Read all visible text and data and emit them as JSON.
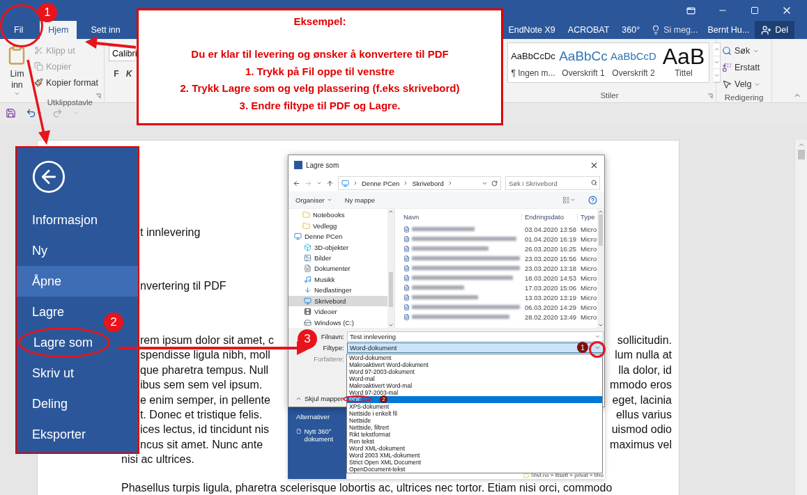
{
  "tabs": [
    {
      "label": "Fil",
      "selected": false
    },
    {
      "label": "Hjem",
      "selected": true
    },
    {
      "label": "Sett inn",
      "selected": false
    },
    {
      "label": "EndNote X9",
      "selected": false
    },
    {
      "label": "ACROBAT",
      "selected": false
    },
    {
      "label": "360°",
      "selected": false
    }
  ],
  "tell_me": {
    "placeholder": "Si meg..."
  },
  "user": "Bernt Hu...",
  "share_button": "Del",
  "ribbon": {
    "clipboard": {
      "paste": "Lim inn",
      "actions": [
        {
          "label": "Klipp ut",
          "kind": "cut",
          "disabled": true
        },
        {
          "label": "Kopier",
          "kind": "copy",
          "disabled": true
        },
        {
          "label": "Kopier format",
          "kind": "format",
          "disabled": false
        }
      ],
      "title": "Utklippstavle"
    },
    "font": {
      "name": "Calibri",
      "buttons": [
        "F",
        "K"
      ]
    },
    "styles": {
      "items": [
        {
          "sample": "AaBbCcDc",
          "label": "¶ Ingen m...",
          "kind": "normal"
        },
        {
          "sample": "AaBbCc",
          "label": "Overskrift 1",
          "kind": "heading1"
        },
        {
          "sample": "AaBbCcD",
          "label": "Overskrift 2",
          "kind": "heading2"
        },
        {
          "sample": "AaB",
          "label": "Tittel",
          "kind": "title"
        }
      ],
      "title": "Stiler"
    },
    "editing": {
      "items": [
        {
          "label": "Søk",
          "kind": "search"
        },
        {
          "label": "Erstatt",
          "kind": "replace"
        },
        {
          "label": "Velg",
          "kind": "select"
        }
      ],
      "title": "Redigering"
    }
  },
  "callout": {
    "title": "Eksempel:",
    "lines": [
      "Du er klar til levering og ønsker å konvertere til PDF",
      "1. Trykk på Fil oppe til venstre",
      "2. Trykk Lagre som og velg plassering (f.eks skrivebord)",
      "3. Endre filtype til PDF og Lagre."
    ]
  },
  "backstage": {
    "items": [
      {
        "label": "Informasjon",
        "selected": false,
        "highlighted": false
      },
      {
        "label": "Ny",
        "selected": false,
        "highlighted": false
      },
      {
        "label": "Åpne",
        "selected": true,
        "highlighted": false
      },
      {
        "label": "Lagre",
        "selected": false,
        "highlighted": false
      },
      {
        "label": "Lagre som",
        "selected": false,
        "highlighted": true
      },
      {
        "label": "Skriv ut",
        "selected": false,
        "highlighted": false
      },
      {
        "label": "Deling",
        "selected": false,
        "highlighted": false
      },
      {
        "label": "Eksporter",
        "selected": false,
        "highlighted": false
      }
    ]
  },
  "document": {
    "headings": [
      "t innlevering",
      "nvertering til PDF"
    ],
    "lines": [
      {
        "left": "rem ipsum dolor sit amet, c",
        "right": "sollicitudin."
      },
      {
        "left": "spendisse ligula nibh, moll",
        "right": "lum nulla at"
      },
      {
        "left": "que pharetra tempus. Null",
        "right": "lla dolor, id"
      },
      {
        "left": "ibus sem sem vel ipsum.",
        "right": "mmodo eros"
      },
      {
        "left": "e enim semper, in pellente",
        "right": "eget, lacinia"
      },
      {
        "left": "t. Donec et tristique felis.",
        "right": "ellus varius"
      },
      {
        "left": "ices lectus, id tincidunt nis",
        "right": "uismod odio"
      },
      {
        "left": "ncus sit amet. Nunc ante",
        "right": "maximus vel"
      }
    ],
    "last_line": "nisi ac ultrices.",
    "next_paragraph": "Phasellus turpis ligula, pharetra scelerisque lobortis ac, ultrices nec tortor. Etiam nisi orci, commodo"
  },
  "dialog": {
    "title": "Lagre som",
    "path": [
      "Denne PCen",
      "Skrivebord"
    ],
    "search": {
      "placeholder": "Søk i Skrivebord"
    },
    "organize": "Organiser",
    "new_folder": "Ny mappe",
    "nav": [
      {
        "label": "Notebooks",
        "kind": "folder",
        "selected": false
      },
      {
        "label": "Vedlegg",
        "kind": "folder",
        "selected": false
      },
      {
        "label": "Denne PCen",
        "kind": "pc",
        "selected": false,
        "children": [
          {
            "label": "3D-objekter",
            "kind": "objects3d",
            "selected": false
          },
          {
            "label": "Bilder",
            "kind": "pictures",
            "selected": false
          },
          {
            "label": "Dokumenter",
            "kind": "documents",
            "selected": false
          },
          {
            "label": "Musikk",
            "kind": "music",
            "selected": false
          },
          {
            "label": "Nedlastinger",
            "kind": "downloads",
            "selected": false
          },
          {
            "label": "Skrivebord",
            "kind": "desktop",
            "selected": true
          },
          {
            "label": "Videoer",
            "kind": "videos",
            "selected": false
          },
          {
            "label": "Windows (C:)",
            "kind": "drive",
            "selected": false
          }
        ]
      }
    ],
    "columns": [
      "Navn",
      "Endringsdato",
      "Type"
    ],
    "rows": [
      {
        "date": "03.04.2020 13:58",
        "type": "Micro"
      },
      {
        "date": "01.04.2020 16:19",
        "type": "Micro"
      },
      {
        "date": "26.03.2020 16:25",
        "type": "Micro"
      },
      {
        "date": "23.03.2020 15:56",
        "type": "Micro"
      },
      {
        "date": "23.03.2020 13:18",
        "type": "Micro"
      },
      {
        "date": "18.03.2020 14:53",
        "type": "Micro"
      },
      {
        "date": "17.03.2020 15:06",
        "type": "Micro"
      },
      {
        "date": "13.03.2020 13:19",
        "type": "Micro"
      },
      {
        "date": "06.03.2020 14:29",
        "type": "Micro"
      },
      {
        "date": "28.02.2020 13:49",
        "type": "Micro"
      }
    ],
    "filename_label": "Filnavn:",
    "filename": "Test innlevering",
    "filetype_label": "Filtype:",
    "filetype": "Word-dokument",
    "authors_label": "Forfattere:",
    "hide_folders": "Skjul mapper",
    "filetype_options": [
      {
        "label": "Word-dokument",
        "selected": false
      },
      {
        "label": "Makroaktivert Word-dokument",
        "selected": false
      },
      {
        "label": "Word 97-2003-dokument",
        "selected": false
      },
      {
        "label": "Word-mal",
        "selected": false
      },
      {
        "label": "Makroaktivert Word-mal",
        "selected": false
      },
      {
        "label": "Word 97-2003-mal",
        "selected": false
      },
      {
        "label": "PDF",
        "selected": true
      },
      {
        "label": "XPS-dokument",
        "selected": false
      },
      {
        "label": "Nettside i enkelt fil",
        "selected": false
      },
      {
        "label": "Nettside",
        "selected": false
      },
      {
        "label": "Nettside, filtrert",
        "selected": false
      },
      {
        "label": "Rikt tekstformat",
        "selected": false
      },
      {
        "label": "Ren tekst",
        "selected": false
      },
      {
        "label": "Word XML-dokument",
        "selected": false
      },
      {
        "label": "Word 2003 XML-dokument",
        "selected": false
      },
      {
        "label": "Strict Open XML Document",
        "selected": false
      },
      {
        "label": "OpenDocument-tekst",
        "selected": false
      }
    ]
  },
  "behind_dialog": {
    "options": "Alternativer",
    "new_doc": "Nytt 360° dokument",
    "location": "\\\\hvl.no » tilsett » privat » bhu"
  },
  "steps": [
    {
      "number": "1",
      "kind": "primary"
    },
    {
      "number": "2",
      "kind": "primary"
    },
    {
      "number": "3",
      "kind": "primary"
    },
    {
      "number": "1",
      "kind": "secondary"
    },
    {
      "number": "2",
      "kind": "secondary"
    }
  ]
}
